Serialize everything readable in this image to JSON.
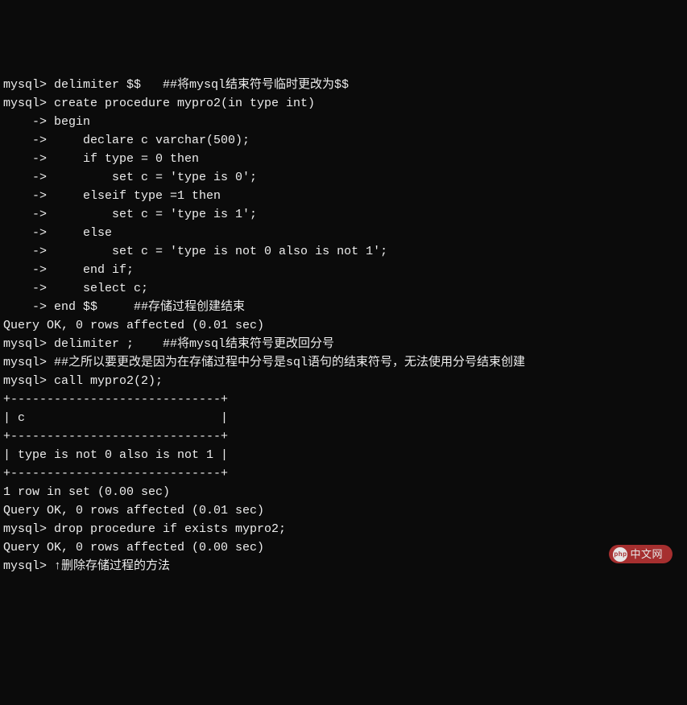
{
  "lines": [
    "mysql> delimiter $$   ##将mysql结束符号临时更改为$$",
    "mysql> create procedure mypro2(in type int)",
    "    -> begin",
    "    ->     declare c varchar(500);",
    "    ->     if type = 0 then",
    "    ->         set c = 'type is 0';",
    "    ->     elseif type =1 then",
    "    ->         set c = 'type is 1';",
    "    ->     else",
    "    ->         set c = 'type is not 0 also is not 1';",
    "    ->     end if;",
    "    ->     select c;",
    "    -> end $$     ##存储过程创建结束",
    "Query OK, 0 rows affected (0.01 sec)",
    "",
    "mysql> delimiter ;    ##将mysql结束符号更改回分号",
    "mysql> ##之所以要更改是因为在存储过程中分号是sql语句的结束符号，无法使用分号结束创建",
    "mysql> call mypro2(2);",
    "+-----------------------------+",
    "| c                           |",
    "+-----------------------------+",
    "| type is not 0 also is not 1 |",
    "+-----------------------------+",
    "1 row in set (0.00 sec)",
    "",
    "Query OK, 0 rows affected (0.01 sec)",
    "",
    "mysql> drop procedure if exists mypro2;",
    "Query OK, 0 rows affected (0.00 sec)",
    "",
    "mysql> ↑删除存储过程的方法"
  ],
  "watermark": "中文网"
}
